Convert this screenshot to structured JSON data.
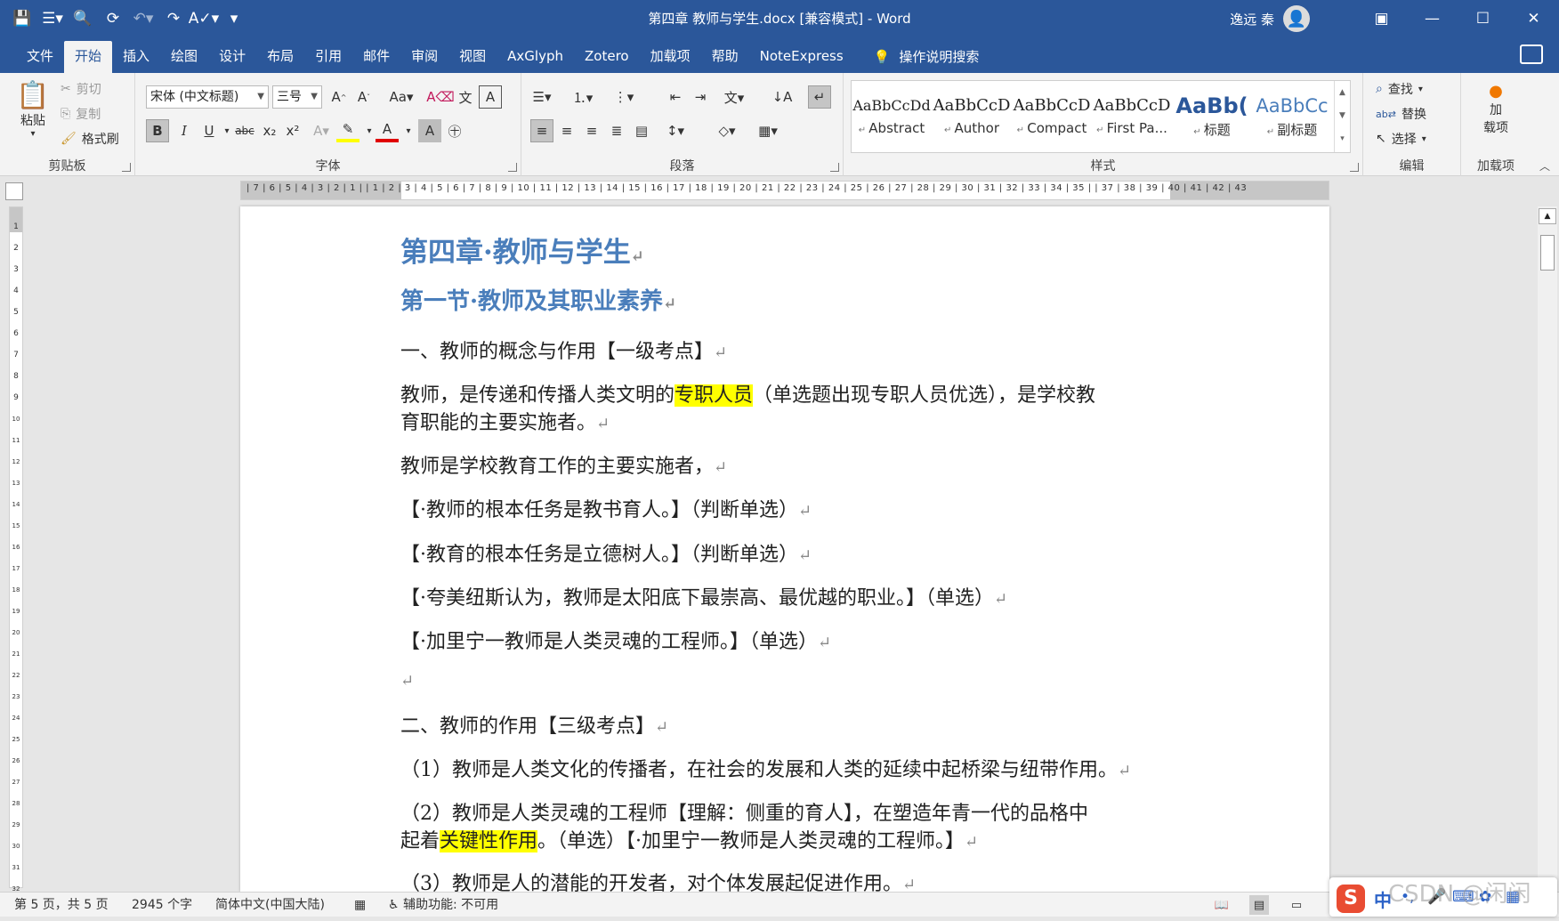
{
  "window": {
    "title": "第四章 教师与学生.docx [兼容模式] - Word",
    "user": "逸远 秦"
  },
  "tabs": [
    "文件",
    "开始",
    "插入",
    "绘图",
    "设计",
    "布局",
    "引用",
    "邮件",
    "审阅",
    "视图",
    "AxGlyph",
    "Zotero",
    "加载项",
    "帮助",
    "NoteExpress"
  ],
  "active_tab": "开始",
  "tell_me": "操作说明搜索",
  "ribbon": {
    "clipboard": {
      "label": "剪贴板",
      "paste": "粘贴",
      "cut": "剪切",
      "copy": "复制",
      "format_painter": "格式刷"
    },
    "font": {
      "label": "字体",
      "font_name": "宋体 (中文标题)",
      "font_size": "三号",
      "change_case": "Aa"
    },
    "paragraph": {
      "label": "段落"
    },
    "styles": {
      "label": "样式",
      "items": [
        {
          "preview": "AaBbCcDd",
          "name": "Abstract"
        },
        {
          "preview": "AaBbCcD",
          "name": "Author"
        },
        {
          "preview": "AaBbCcD",
          "name": "Compact"
        },
        {
          "preview": "AaBbCcD",
          "name": "First Pa..."
        },
        {
          "preview": "AaBb(",
          "name": "标题"
        },
        {
          "preview": "AaBbCc",
          "name": "副标题"
        }
      ]
    },
    "editing": {
      "label": "编辑",
      "find": "查找",
      "replace": "替换",
      "select": "选择"
    },
    "addins": {
      "label": "加载项",
      "button_line1": "加",
      "button_line2": "载项"
    }
  },
  "ruler": {
    "horizontal_text": "| 7 | 6 | 5 | 4 | 3 | 2 | 1 |     | 1 | 2 | 3 | 4 | 5 | 6 | 7 | 8 | 9 | 10 | 11 | 12 | 13 | 14 | 15 | 16 | 17 | 18 | 19 | 20 | 21 | 22 | 23 | 24 | 25 | 26 | 27 | 28 | 29 | 30 | 31 | 32 | 33 | 34 | 35 |     | 37 | 38 | 39 | 40 | 41 | 42 | 43",
    "vertical_text": "1 2 3 4 5 6 7 8 9 10 11 12 13 14 15 16 17 18 19 20 21 22 23 24 25 26 27 28 29 30 31 32 33"
  },
  "document": {
    "paragraph_mark": "↵",
    "heading1": "第四章·教师与学生",
    "heading2": "第一节·教师及其职业素养",
    "section1": "一、教师的概念与作用【一级考点】",
    "p1_before": "教师，是传递和传播人类文明的",
    "p1_highlight": "专职人员",
    "p1_after": "（单选题出现专职人员优选），是学校教",
    "p1_line2": "育职能的主要实施者。",
    "p2": "教师是学校教育工作的主要实施者，",
    "p3": "【·教师的根本任务是教书育人。】（判断单选）",
    "p4": "【·教育的根本任务是立德树人。】（判断单选）",
    "p5": "【·夸美纽斯认为，教师是太阳底下最崇高、最优越的职业。】（单选）",
    "p6": "【·加里宁一教师是人类灵魂的工程师。】（单选）",
    "section2": "二、教师的作用【三级考点】",
    "p7": "（1）教师是人类文化的传播者，在社会的发展和人类的延续中起桥梁与纽带作用。",
    "p8_line1": "（2）教师是人类灵魂的工程师【理解：侧重的育人】，在塑造年青一代的品格中",
    "p8_before": "起着",
    "p8_highlight": "关键性作用",
    "p8_after": "。（单选）【·加里宁一教师是人类灵魂的工程师。】",
    "p9": "（3）教师是人的潜能的开发者，对个体发展起促进作用。"
  },
  "status": {
    "page": "第 5 页，共 5 页",
    "words": "2945 个字",
    "language": "简体中文(中国大陆)",
    "accessibility": "辅助功能: 不可用"
  },
  "ime": {
    "logo": "S",
    "mode": "中"
  },
  "watermark": "CSDN @闲闲",
  "colors": {
    "brand": "#2b579a",
    "heading": "#4a7ebb",
    "highlight": "#ffff00"
  }
}
